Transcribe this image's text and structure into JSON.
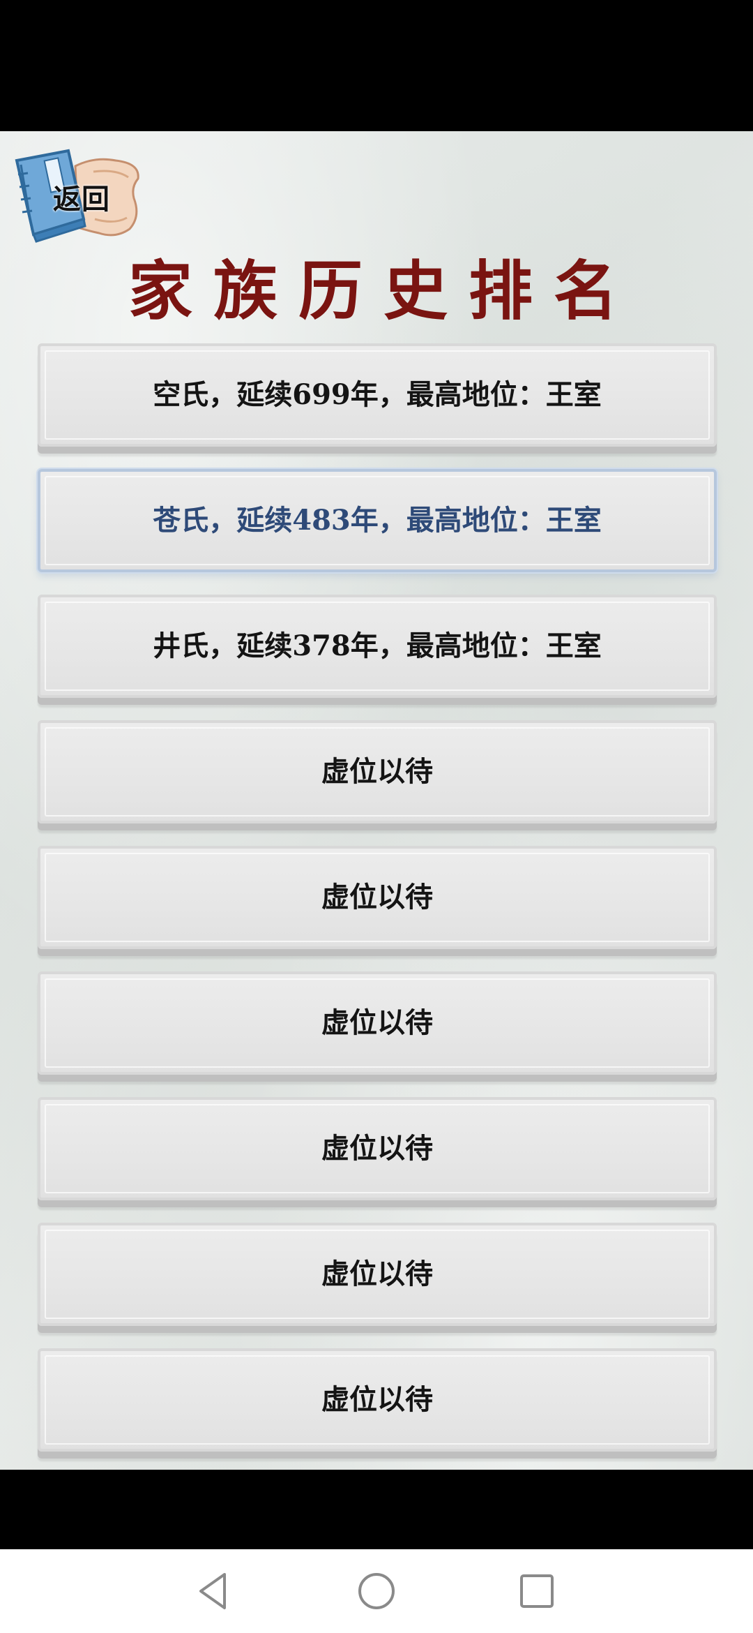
{
  "header": {
    "back_label": "返回",
    "title": "家族历史排名"
  },
  "ranking": {
    "items": [
      {
        "label": "空氏，延续699年，最高地位：王室",
        "selected": false
      },
      {
        "label": "苍氏，延续483年，最高地位：王室",
        "selected": true
      },
      {
        "label": "井氏，延续378年，最高地位：王室",
        "selected": false
      },
      {
        "label": "虚位以待",
        "selected": false
      },
      {
        "label": "虚位以待",
        "selected": false
      },
      {
        "label": "虚位以待",
        "selected": false
      },
      {
        "label": "虚位以待",
        "selected": false
      },
      {
        "label": "虚位以待",
        "selected": false
      },
      {
        "label": "虚位以待",
        "selected": false
      }
    ]
  },
  "colors": {
    "title": "#7a1411",
    "selected_text": "#2e4a78",
    "normal_text": "#141414"
  },
  "system_nav": {
    "icons": [
      "back-triangle-icon",
      "home-circle-icon",
      "recents-square-icon"
    ]
  }
}
